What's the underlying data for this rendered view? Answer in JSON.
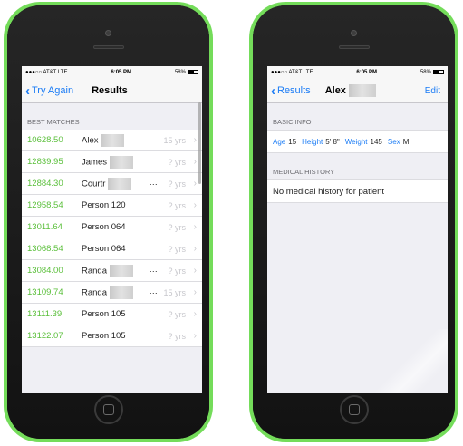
{
  "left_phone": {
    "status": {
      "carrier": "●●●○○ AT&T  LTE",
      "time": "6:05 PM",
      "battery": "58%"
    },
    "nav": {
      "back_label": "Try Again",
      "title": "Results"
    },
    "section_header": "BEST MATCHES",
    "rows": [
      {
        "score": "10628.50",
        "name": "Alex",
        "redacted": true,
        "ellipsis": "",
        "age": "15 yrs"
      },
      {
        "score": "12839.95",
        "name": "James",
        "redacted": true,
        "ellipsis": "",
        "age": "? yrs"
      },
      {
        "score": "12884.30",
        "name": "Courtr",
        "redacted": true,
        "ellipsis": "…",
        "age": "? yrs"
      },
      {
        "score": "12958.54",
        "name": "Person 120",
        "redacted": false,
        "ellipsis": "",
        "age": "? yrs"
      },
      {
        "score": "13011.64",
        "name": "Person 064",
        "redacted": false,
        "ellipsis": "",
        "age": "? yrs"
      },
      {
        "score": "13068.54",
        "name": "Person 064",
        "redacted": false,
        "ellipsis": "",
        "age": "? yrs"
      },
      {
        "score": "13084.00",
        "name": "Randa",
        "redacted": true,
        "ellipsis": "…",
        "age": "? yrs"
      },
      {
        "score": "13109.74",
        "name": "Randa",
        "redacted": true,
        "ellipsis": "…",
        "age": "15 yrs"
      },
      {
        "score": "13111.39",
        "name": "Person 105",
        "redacted": false,
        "ellipsis": "",
        "age": "? yrs"
      },
      {
        "score": "13122.07",
        "name": "Person 105",
        "redacted": false,
        "ellipsis": "",
        "age": "? yrs"
      }
    ]
  },
  "right_phone": {
    "status": {
      "carrier": "●●●○○ AT&T  LTE",
      "time": "6:05 PM",
      "battery": "58%"
    },
    "nav": {
      "back_label": "Results",
      "title": "Alex",
      "edit_label": "Edit"
    },
    "basic_info_header": "BASIC INFO",
    "basic_info": [
      {
        "key": "Age",
        "value": "15"
      },
      {
        "key": "Height",
        "value": "5' 8\""
      },
      {
        "key": "Weight",
        "value": "145"
      },
      {
        "key": "Sex",
        "value": "M"
      }
    ],
    "medical_history_header": "MEDICAL HISTORY",
    "medical_history_text": "No medical history for patient"
  },
  "colors": {
    "phone_case": "#74dc5a",
    "accent_blue": "#1b7cf5",
    "score_green": "#5abf3a"
  },
  "icons": [
    "back-chevron-icon",
    "disclosure-chevron-icon",
    "battery-icon",
    "camera-icon",
    "home-button-icon"
  ]
}
